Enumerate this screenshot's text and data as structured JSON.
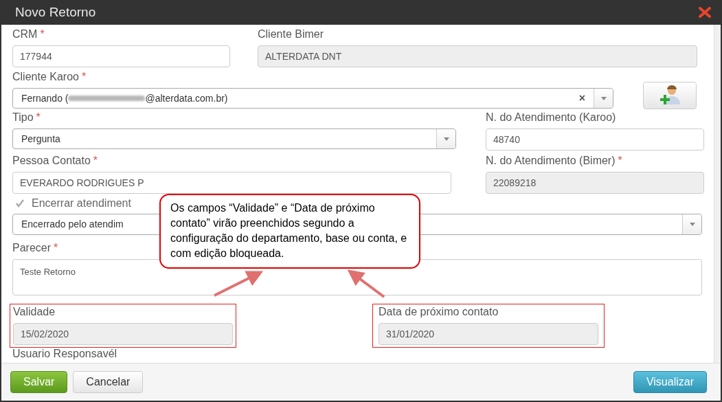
{
  "title": "Novo Retorno",
  "crm": {
    "label": "CRM",
    "required_mark": "*",
    "value": "177944",
    "disabled": false
  },
  "cliente_bimer": {
    "label": "Cliente Bimer",
    "value": "ALTERDATA DNT",
    "disabled": true
  },
  "cliente_karoo": {
    "label": "Cliente Karoo",
    "required_mark": "*",
    "value_start": "Fernando (",
    "value_end": "@alterdata.com.br)",
    "redacted": true,
    "clear_symbol": "×"
  },
  "tipo": {
    "label": "Tipo",
    "required_mark": "*",
    "value": "Pergunta"
  },
  "atendimento_karoo": {
    "label": "N. do Atendimento (Karoo)",
    "value": "48740",
    "disabled": false
  },
  "pessoa_contato": {
    "label": "Pessoa Contato",
    "required_mark": "*",
    "value": "EVERARDO RODRIGUES P",
    "disabled": false
  },
  "atendimento_bimer": {
    "label": "N. do Atendimento (Bimer)",
    "required_mark": "*",
    "value": "22089218",
    "disabled": true
  },
  "encerrar": {
    "label": "Encerrar atendiment",
    "checked": true
  },
  "encerramento": {
    "value": "Encerrado pelo atendim"
  },
  "parecer": {
    "label": "Parecer",
    "required_mark": "*",
    "value": "Teste Retorno"
  },
  "validade": {
    "label": "Validade",
    "value": "15/02/2020",
    "disabled": true
  },
  "proximo_contato": {
    "label": "Data de próximo contato",
    "value": "31/01/2020",
    "disabled": true
  },
  "usuario_responsavel": {
    "label": "Usuario Responsavél"
  },
  "callout": {
    "text": "Os campos “Validade” e “Data de próximo contato” virão preenchidos segundo a configuração do departamento, base ou conta, e com edição bloqueada."
  },
  "buttons": [
    {
      "label": "Salvar",
      "kind": "success"
    },
    {
      "label": "Cancelar",
      "kind": "default"
    },
    {
      "label": "Visualizar",
      "kind": "info"
    }
  ]
}
